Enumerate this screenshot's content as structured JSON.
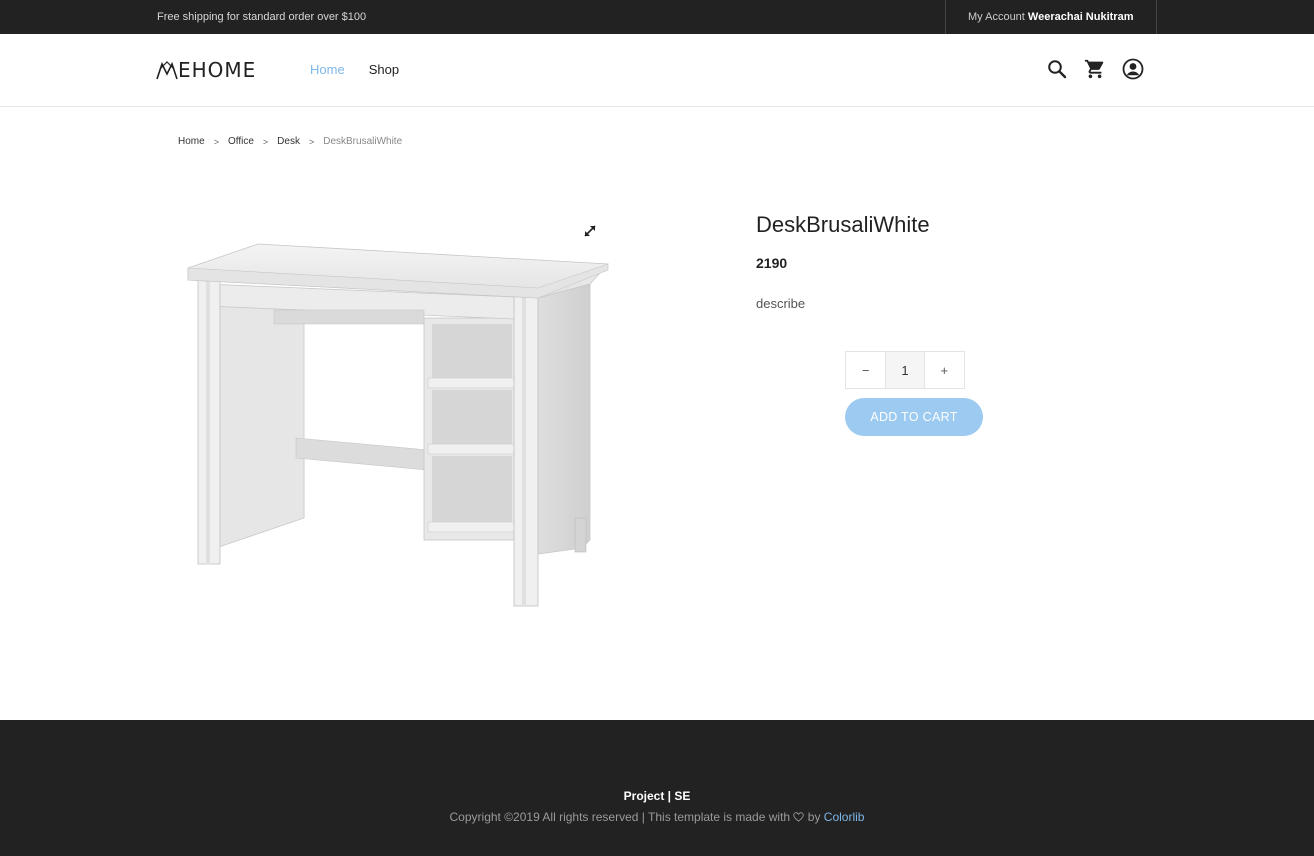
{
  "topbar": {
    "shipping_text": "Free shipping for standard order over $100",
    "account_label": "My Account",
    "account_name": "Weerachai Nukitram"
  },
  "header": {
    "logo_text": "EHOME",
    "nav": {
      "home": "Home",
      "shop": "Shop"
    },
    "icons": [
      "search-icon",
      "cart-icon",
      "user-icon"
    ]
  },
  "breadcrumb": {
    "items": [
      "Home",
      "Office",
      "Desk"
    ],
    "separator": ">",
    "current": "DeskBrusaliWhite"
  },
  "product": {
    "name": "DeskBrusaliWhite",
    "price": "2190",
    "description": "describe",
    "quantity": "1",
    "minus": "−",
    "plus": "+",
    "add_to_cart": "ADD TO CART"
  },
  "footer": {
    "project": "Project | SE",
    "copyright_prefix": "Copyright ©2019 All rights reserved | This template is made with",
    "copyright_by": "by",
    "brand": "Colorlib"
  },
  "colors": {
    "accent": "#7fb6e8",
    "button": "#9ccaf0",
    "dark": "#222222"
  }
}
